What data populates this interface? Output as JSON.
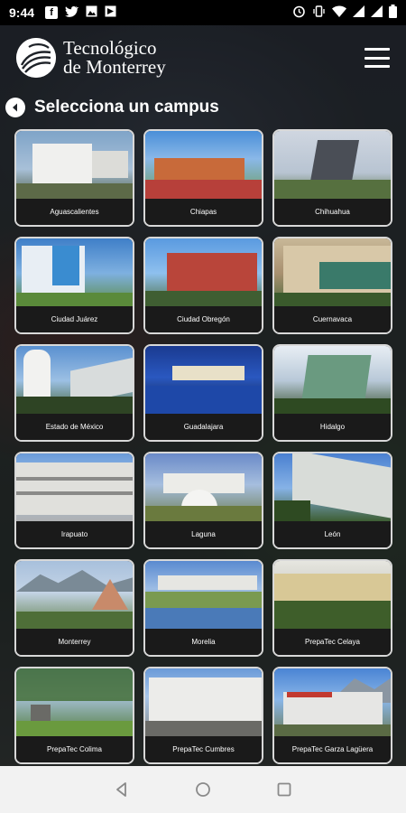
{
  "status_bar": {
    "time": "9:44",
    "left_icons": [
      "facebook-icon",
      "twitter-icon",
      "image-icon",
      "notification-icon"
    ],
    "right_icons": [
      "alarm-icon",
      "vibrate-icon",
      "wifi-icon",
      "signal-icon",
      "signal-icon",
      "battery-icon"
    ]
  },
  "header": {
    "logo_line1": "Tecnológico",
    "logo_line2": "de Monterrey",
    "menu_icon": "hamburger-menu-icon"
  },
  "page": {
    "title": "Selecciona un campus",
    "back_icon": "back-arrow-icon"
  },
  "campuses": [
    {
      "label": "Aguascalientes"
    },
    {
      "label": "Chiapas"
    },
    {
      "label": "Chihuahua"
    },
    {
      "label": "Ciudad Juárez"
    },
    {
      "label": "Ciudad Obregón"
    },
    {
      "label": "Cuernavaca"
    },
    {
      "label": "Estado de México"
    },
    {
      "label": "Guadalajara"
    },
    {
      "label": "Hidalgo"
    },
    {
      "label": "Irapuato"
    },
    {
      "label": "Laguna"
    },
    {
      "label": "León"
    },
    {
      "label": "Monterrey"
    },
    {
      "label": "Morelia"
    },
    {
      "label": "PrepaTec Celaya"
    },
    {
      "label": "PrepaTec Colima"
    },
    {
      "label": "PrepaTec Cumbres"
    },
    {
      "label": "PrepaTec Garza Lagüera"
    }
  ],
  "nav_bar": {
    "icons": [
      "nav-back-icon",
      "nav-home-icon",
      "nav-recents-icon"
    ]
  }
}
